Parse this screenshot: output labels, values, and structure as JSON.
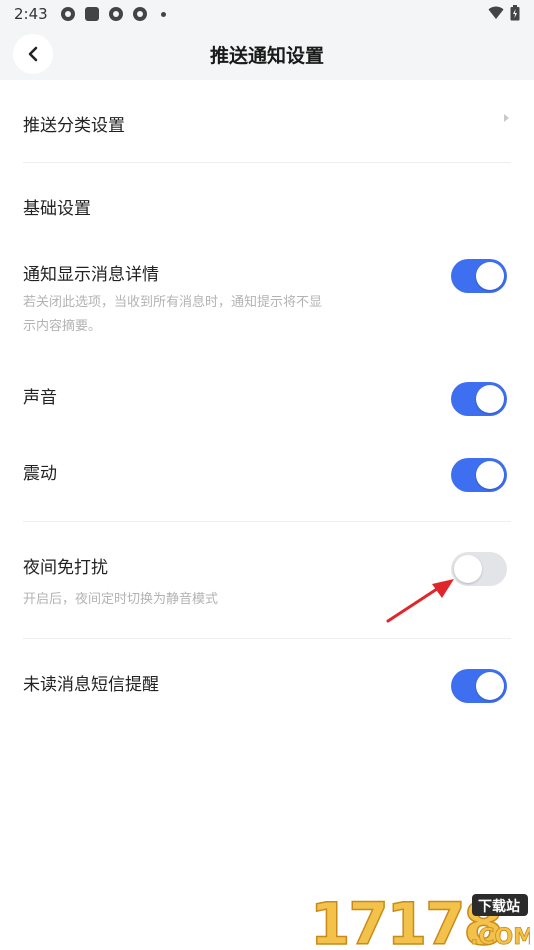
{
  "status_bar": {
    "time": "2:43"
  },
  "header": {
    "title": "推送通知设置"
  },
  "rows": {
    "push_category": {
      "label": "推送分类设置"
    },
    "notify_detail": {
      "label": "通知显示消息详情",
      "sub": "若关闭此选项，当收到所有消息时，通知提示将不显示内容摘要。",
      "enabled": true
    },
    "sound": {
      "label": "声音",
      "enabled": true
    },
    "vibrate": {
      "label": "震动",
      "enabled": true
    },
    "night_dnd": {
      "label": "夜间免打扰",
      "sub": "开启后，夜间定时切换为静音模式",
      "enabled": false
    },
    "unread_sms": {
      "label": "未读消息短信提醒",
      "enabled": true
    }
  },
  "section": {
    "basic": "基础设置"
  },
  "watermark": {
    "text": "17178",
    "badge": "下载站",
    "domain": ".COM"
  },
  "colors": {
    "accent": "#3e6ff0",
    "toggle_off": "#e3e4e8",
    "annotation_arrow": "#e0262b"
  }
}
